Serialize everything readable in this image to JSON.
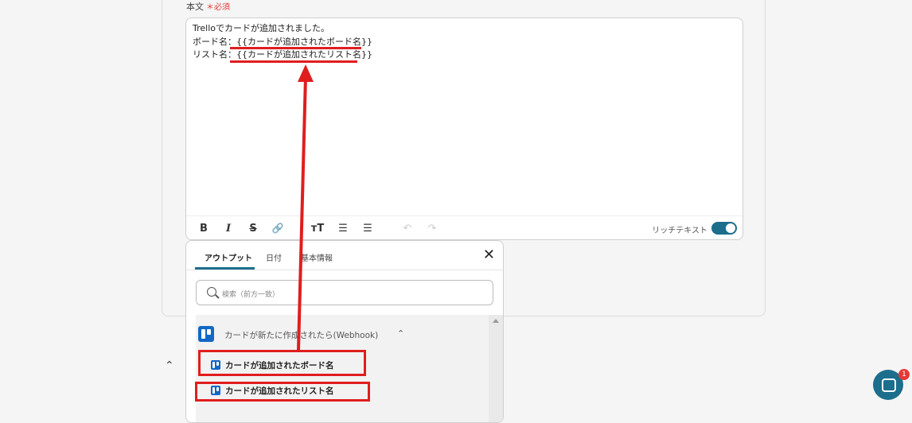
{
  "form": {
    "field_label": "本文",
    "required_mark": "＊",
    "required_text": "必須",
    "body_lines": [
      {
        "prefix": "",
        "text": "Trelloでカードが追加されました。"
      },
      {
        "prefix": "ボード名：",
        "text": "{{カードが追加されたボード名}}"
      },
      {
        "prefix": "リスト名：",
        "text": "{{カードが追加されたリスト名}}"
      }
    ]
  },
  "toolbar": {
    "icons": [
      "bold-icon",
      "italic-icon",
      "strikethrough-icon",
      "link-icon",
      "text-size-icon",
      "bullet-list-icon",
      "numbered-list-icon",
      "undo-icon",
      "redo-icon"
    ],
    "bold": "B",
    "italic": "I",
    "strike": "S",
    "link": "🔗",
    "text_size": "ᴛT",
    "bullet": "☰",
    "numbered": "☰",
    "undo": "↶",
    "redo": "↷",
    "rich_text_label": "リッチテキスト",
    "rich_text_enabled": true
  },
  "popup": {
    "tabs": [
      {
        "label": "アウトプット",
        "active": true
      },
      {
        "label": "日付",
        "active": false
      },
      {
        "label": "基本情報",
        "active": false
      }
    ],
    "close": "✕",
    "search_placeholder": "検索（前方一致）",
    "group": {
      "label": "カードが新たに作成されたら(Webhook)",
      "chevron": "⌃",
      "icon": "trello-icon",
      "items": [
        {
          "label": "カードが追加されたボード名",
          "icon": "trello-icon"
        },
        {
          "label": "カードが追加されたリスト名",
          "icon": "trello-icon"
        }
      ]
    }
  },
  "page": {
    "collapse_chevron": "⌃",
    "chat_badge": "1"
  },
  "colors": {
    "accent": "#1c6e8c",
    "highlight": "#e01e1e",
    "required": "#e53935",
    "trello": "#1168c5"
  }
}
